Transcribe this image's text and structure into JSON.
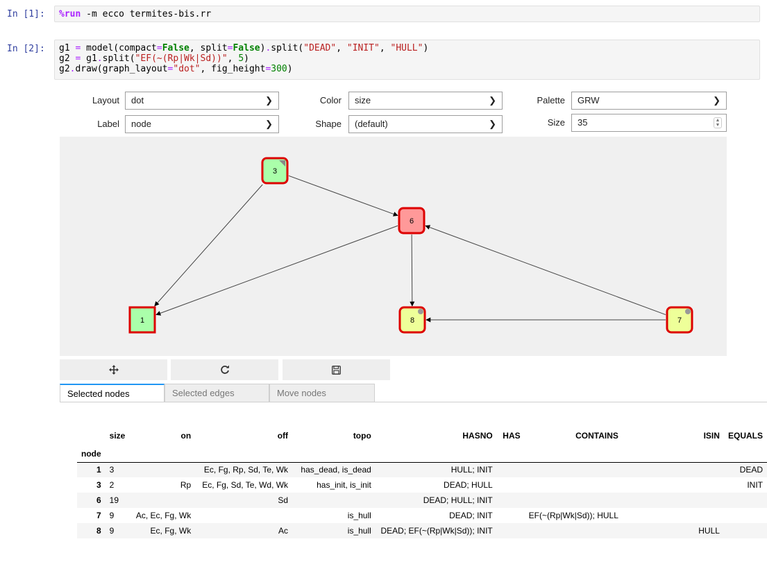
{
  "cells": [
    {
      "prompt": "In [1]:"
    },
    {
      "prompt": "In [2]:"
    }
  ],
  "controls": {
    "layout": {
      "label": "Layout",
      "value": "dot"
    },
    "color": {
      "label": "Color",
      "value": "size"
    },
    "palette": {
      "label": "Palette",
      "value": "GRW"
    },
    "label": {
      "label": "Label",
      "value": "node"
    },
    "shape": {
      "label": "Shape",
      "value": "(default)"
    },
    "size": {
      "label": "Size",
      "value": "35"
    }
  },
  "graph": {
    "nodes": [
      {
        "id": "3",
        "fill": "#aaffaa",
        "marker": "triangle"
      },
      {
        "id": "6",
        "fill": "#ff9999",
        "marker": "none"
      },
      {
        "id": "1",
        "fill": "#aaffaa",
        "marker": "none"
      },
      {
        "id": "8",
        "fill": "#eeff99",
        "marker": "circle"
      },
      {
        "id": "7",
        "fill": "#eeff99",
        "marker": "circle"
      }
    ],
    "edges": [
      {
        "from": "3",
        "to": "6"
      },
      {
        "from": "3",
        "to": "1"
      },
      {
        "from": "6",
        "to": "1"
      },
      {
        "from": "6",
        "to": "8"
      },
      {
        "from": "7",
        "to": "8"
      },
      {
        "from": "7",
        "to": "6"
      }
    ],
    "border_color": "#dd0000"
  },
  "toolbar": {
    "move_icon": "move-icon",
    "refresh_icon": "refresh-icon",
    "save_icon": "save-icon"
  },
  "tabs": [
    {
      "label": "Selected nodes",
      "active": true
    },
    {
      "label": "Selected edges",
      "active": false
    },
    {
      "label": "Move nodes",
      "active": false
    }
  ],
  "table": {
    "columns": [
      "size",
      "on",
      "off",
      "topo",
      "HASNO",
      "HAS",
      "CONTAINS",
      "ISIN",
      "EQUALS"
    ],
    "index_name": "node",
    "rows": [
      {
        "node": "1",
        "cells": [
          "3",
          "",
          "Ec, Fg, Rp, Sd, Te, Wk",
          "has_dead, is_dead",
          "HULL; INIT",
          "",
          "",
          "",
          "DEAD"
        ]
      },
      {
        "node": "3",
        "cells": [
          "2",
          "Rp",
          "Ec, Fg, Sd, Te, Wd, Wk",
          "has_init, is_init",
          "DEAD; HULL",
          "",
          "",
          "",
          "INIT"
        ]
      },
      {
        "node": "6",
        "cells": [
          "19",
          "",
          "Sd",
          "",
          "DEAD; HULL; INIT",
          "",
          "",
          "",
          ""
        ]
      },
      {
        "node": "7",
        "cells": [
          "9",
          "Ac, Ec, Fg, Wk",
          "",
          "is_hull",
          "DEAD; INIT",
          "",
          "EF(~(Rp|Wk|Sd)); HULL",
          "",
          ""
        ]
      },
      {
        "node": "8",
        "cells": [
          "9",
          "Ec, Fg, Wk",
          "Ac",
          "is_hull",
          "DEAD; EF(~(Rp|Wk|Sd)); INIT",
          "",
          "",
          "HULL",
          ""
        ]
      }
    ]
  }
}
